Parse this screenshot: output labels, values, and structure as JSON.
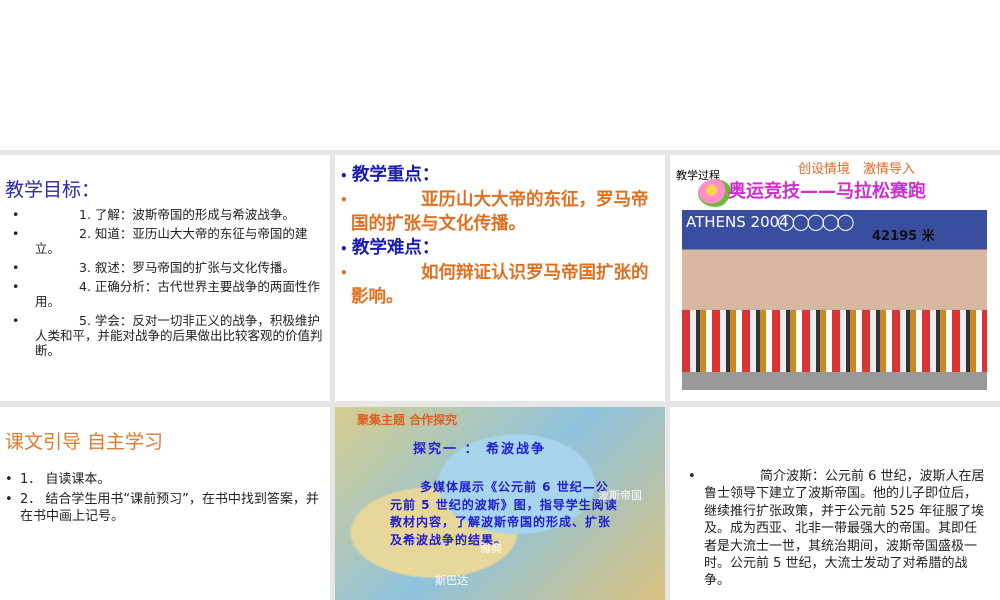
{
  "objectives": {
    "title": "教学目标：",
    "items": [
      "1. 了解：波斯帝国的形成与希波战争。",
      "2. 知道：亚历山大大帝的东征与帝国的建立。",
      "3. 叙述：罗马帝国的扩张与文化传播。",
      "4. 正确分析：古代世界主要战争的两面性作用。",
      "5. 学会：反对一切非正义的战争，积极维护人类和平，并能对战争的后果做出比较客观的价值判断。"
    ]
  },
  "key_points": {
    "focus_label": "教学重点：",
    "focus_text": "亚历山大大帝的东征，罗马帝国的扩张与文化传播。",
    "difficulty_label": "教学难点：",
    "difficulty_text": "如何辩证认识罗马帝国扩张的影响。"
  },
  "process": {
    "label": "教学过程",
    "subtitle": "创设情境　激情导入",
    "title": "奥运竞技——马拉松赛跑",
    "banner": "ATHENS 2004",
    "distance": "42195 米"
  },
  "self_study": {
    "title": "课文引导  自主学习",
    "items": [
      "1． 自读课本。",
      "2． 结合学生用书“课前预习”，在书中找到答案，并在书中画上记号。"
    ]
  },
  "map": {
    "theme": "聚集主题  合作探究",
    "inquiry": "探究一 ： 希波战争",
    "instruction": "多媒体展示《公元前 6 世纪—公元前 5 世纪的波斯》图，指导学生阅读教材内容，了解波斯帝国的形成、扩张及希波战争的结果。",
    "places": [
      "波斯帝国",
      "雅典",
      "斯巴达"
    ]
  },
  "persia": {
    "text": "简介波斯：公元前 6 世纪，波斯人在居鲁士领导下建立了波斯帝国。他的儿子即位后，继续推行扩张政策，并于公元前 525 年征服了埃及。成为西亚、北非一带最强大的帝国。其即任者是大流士一世，其统治期间，波斯帝国盛极一时。公元前 5 世纪，大流士发动了对希腊的战争。"
  }
}
